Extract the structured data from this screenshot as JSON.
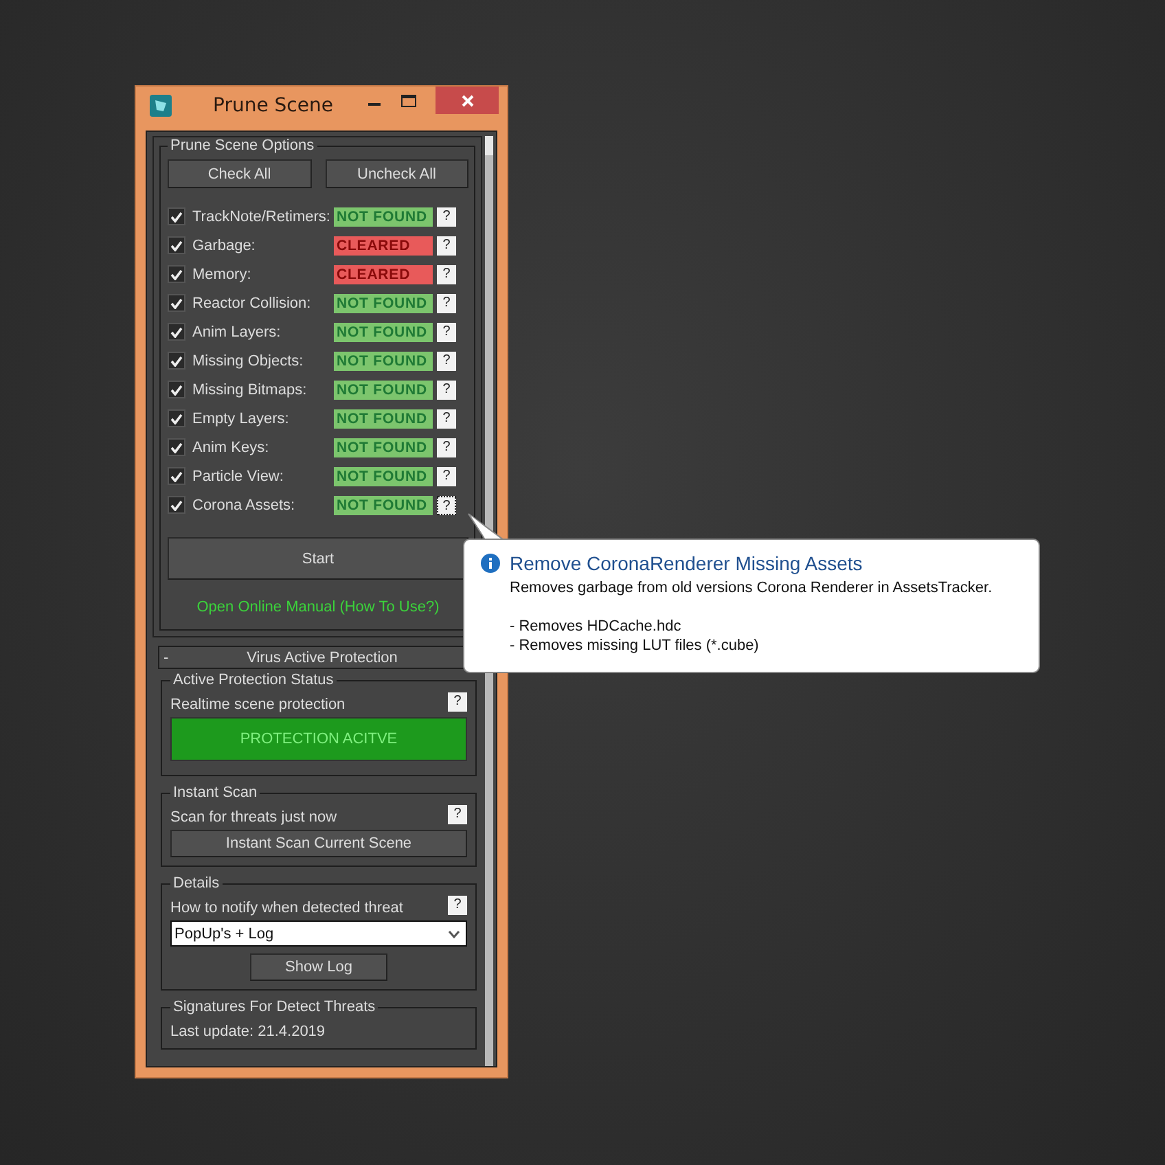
{
  "window": {
    "title": "Prune Scene"
  },
  "prune_options": {
    "title": "Prune Scene Options",
    "buttons": [
      "Check All",
      "Uncheck All"
    ],
    "items": [
      {
        "label": "TrackNote/Retimers:",
        "checked": true,
        "status": "NOT FOUND",
        "kind": "not_found",
        "help": "?",
        "focused": false
      },
      {
        "label": "Garbage:",
        "checked": true,
        "status": "CLEARED",
        "kind": "cleared",
        "help": "?",
        "focused": false
      },
      {
        "label": "Memory:",
        "checked": true,
        "status": "CLEARED",
        "kind": "cleared",
        "help": "?",
        "focused": false
      },
      {
        "label": "Reactor Collision:",
        "checked": true,
        "status": "NOT FOUND",
        "kind": "not_found",
        "help": "?",
        "focused": false
      },
      {
        "label": "Anim Layers:",
        "checked": true,
        "status": "NOT FOUND",
        "kind": "not_found",
        "help": "?",
        "focused": false
      },
      {
        "label": "Missing Objects:",
        "checked": true,
        "status": "NOT FOUND",
        "kind": "not_found",
        "help": "?",
        "focused": false
      },
      {
        "label": "Missing Bitmaps:",
        "checked": true,
        "status": "NOT FOUND",
        "kind": "not_found",
        "help": "?",
        "focused": false
      },
      {
        "label": "Empty Layers:",
        "checked": true,
        "status": "NOT FOUND",
        "kind": "not_found",
        "help": "?",
        "focused": false
      },
      {
        "label": "Anim Keys:",
        "checked": true,
        "status": "NOT FOUND",
        "kind": "not_found",
        "help": "?",
        "focused": false
      },
      {
        "label": "Particle View:",
        "checked": true,
        "status": "NOT FOUND",
        "kind": "not_found",
        "help": "?",
        "focused": false
      },
      {
        "label": "Corona Assets:",
        "checked": true,
        "status": "NOT FOUND",
        "kind": "not_found",
        "help": "?",
        "focused": true
      }
    ],
    "start_button": "Start",
    "manual_link": "Open Online Manual (How To Use?)"
  },
  "rollout": {
    "toggle": "-",
    "title": "Virus Active Protection",
    "expanded": true
  },
  "active_protection": {
    "title": "Active Protection Status",
    "label": "Realtime scene protection",
    "help": "?",
    "status_button": "PROTECTION ACITVE",
    "active": true
  },
  "instant_scan": {
    "title": "Instant Scan",
    "label": "Scan for threats just now",
    "help": "?",
    "button": "Instant Scan Current Scene"
  },
  "details": {
    "title": "Details",
    "label": "How to notify when detected threat",
    "help": "?",
    "dropdown": "PopUp's + Log",
    "button": "Show Log"
  },
  "signatures": {
    "title": "Signatures For Detect Threats",
    "last_update": "Last update: 21.4.2019"
  },
  "tooltip": {
    "title": "Remove CoronaRenderer Missing Assets",
    "description": "Removes garbage from old versions Corona Renderer in AssetsTracker.",
    "bullets": [
      "- Removes HDCache.hdc",
      "- Removes missing LUT files (*.cube)"
    ]
  }
}
